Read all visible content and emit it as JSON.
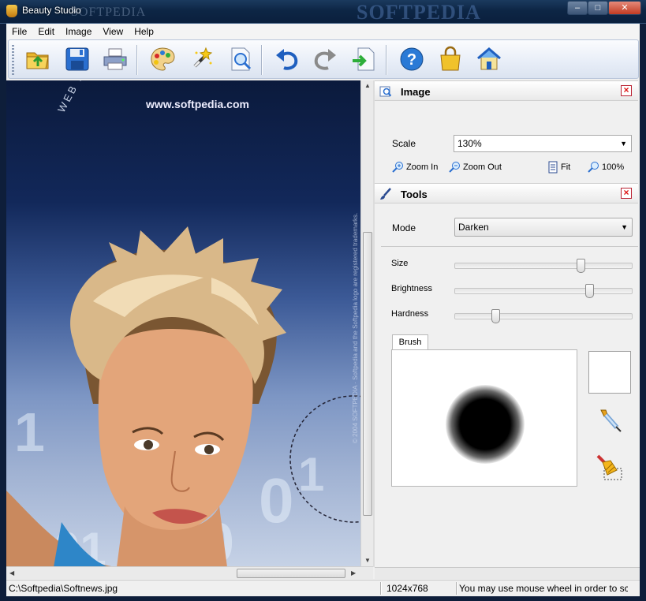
{
  "window": {
    "title": "Beauty Studio",
    "watermark": "SOFTPEDIA",
    "title_watermark_left": "SOFTPEDIA",
    "controls": {
      "minimize": "–",
      "maximize": "□",
      "close": "✕"
    }
  },
  "menu": [
    "File",
    "Edit",
    "Image",
    "View",
    "Help"
  ],
  "toolbar": [
    {
      "name": "open",
      "icon": "folder-open-icon"
    },
    {
      "name": "save",
      "icon": "floppy-disk-icon"
    },
    {
      "name": "print",
      "icon": "printer-icon"
    },
    {
      "name": "palette",
      "icon": "palette-icon"
    },
    {
      "name": "magic-wand",
      "icon": "magic-wand-icon"
    },
    {
      "name": "preview",
      "icon": "magnifier-page-icon"
    },
    {
      "name": "undo",
      "icon": "undo-arrow-icon"
    },
    {
      "name": "redo",
      "icon": "redo-arrow-icon"
    },
    {
      "name": "export",
      "icon": "export-page-icon"
    },
    {
      "name": "help",
      "icon": "help-icon"
    },
    {
      "name": "buy",
      "icon": "shopping-bag-icon"
    },
    {
      "name": "home",
      "icon": "home-icon"
    }
  ],
  "canvas": {
    "url_text": "www.softpedia.com",
    "web_text": "WEB ENTE",
    "side_text": "© 2004 SOFTPEDIA · Softpedia and the Softpedia logo are registered trademarks."
  },
  "image_panel": {
    "title": "Image",
    "scale_label": "Scale",
    "scale_value": "130%",
    "zoom_in": "Zoom In",
    "zoom_out": "Zoom Out",
    "fit": "Fit",
    "actual": "100%"
  },
  "tools_panel": {
    "title": "Tools",
    "mode_label": "Mode",
    "mode_value": "Darken",
    "size_label": "Size",
    "size_value": 0.72,
    "brightness_label": "Brightness",
    "brightness_value": 0.77,
    "hardness_label": "Hardness",
    "hardness_value": 0.22,
    "brush_tab": "Brush"
  },
  "status": {
    "path": "C:\\Softpedia\\Softnews.jpg",
    "dimensions": "1024x768",
    "hint": "You may use mouse wheel in order to sc"
  }
}
